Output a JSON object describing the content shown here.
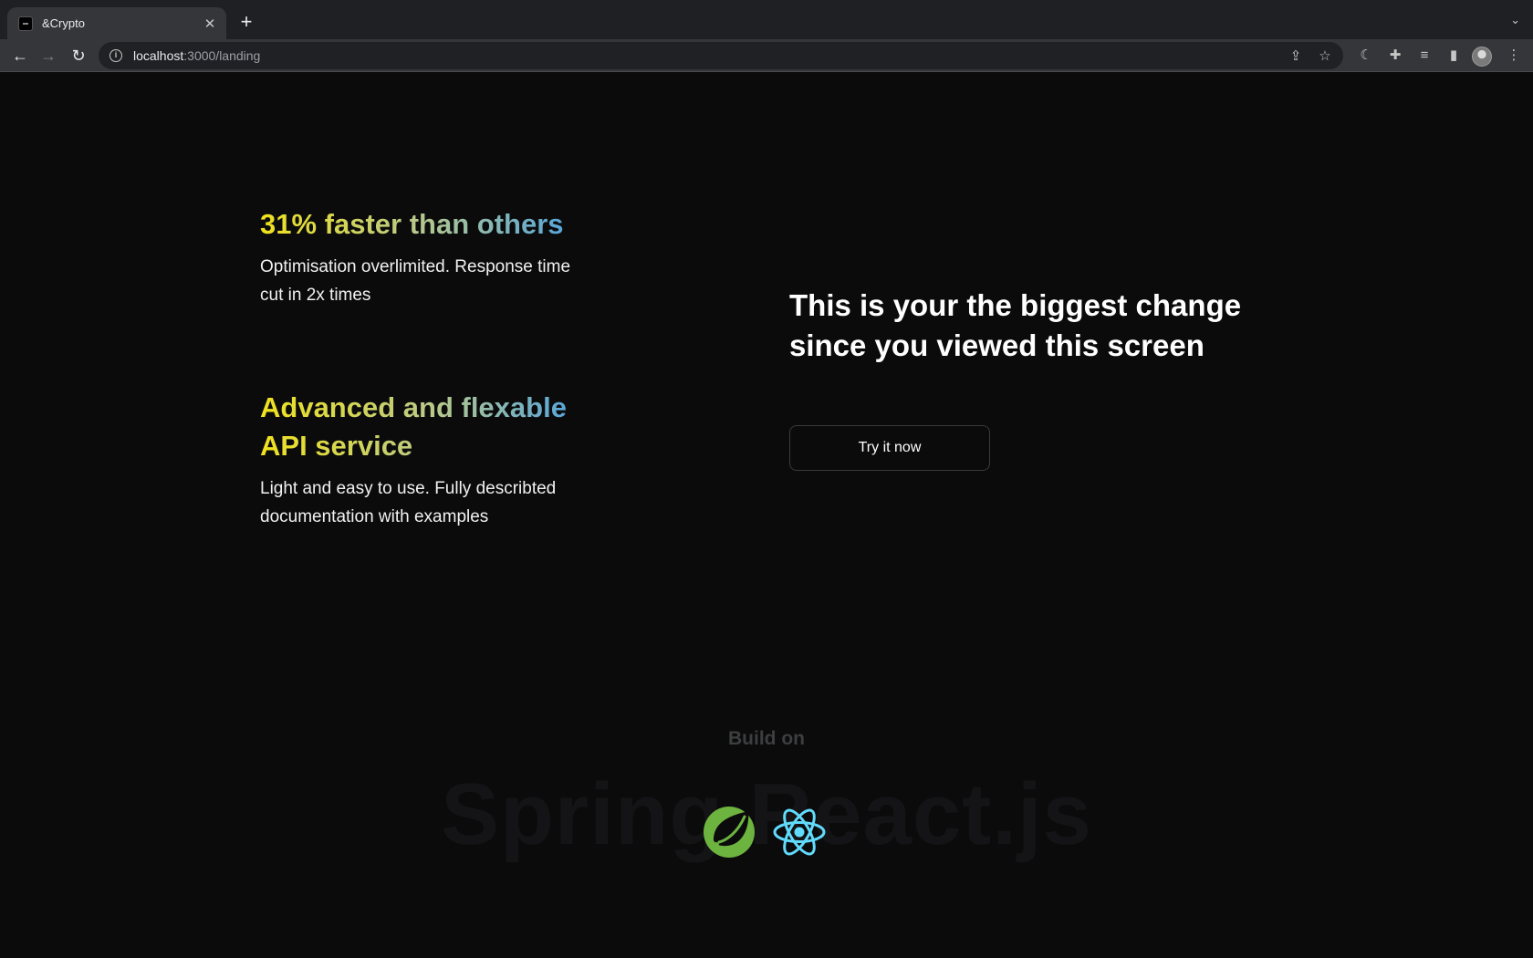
{
  "browser": {
    "tab_title": "&Crypto",
    "url_host": "localhost",
    "url_path": ":3000/landing"
  },
  "features": [
    {
      "title": "31% faster than others",
      "description": "Optimisation overlimited. Response time cut in 2x times"
    },
    {
      "title": "Advanced and flexable API service",
      "description": "Light and easy to use. Fully describted documentation with examples"
    }
  ],
  "hero": {
    "headline": "This is your the biggest change since you viewed this screen",
    "cta_label": "Try it now"
  },
  "build_on": {
    "label": "Build on",
    "background_text": "Spring React.js",
    "logos": [
      "spring-icon",
      "react-icon"
    ]
  },
  "colors": {
    "gradient_start": "#f1e21c",
    "gradient_mid": "#b8c98a",
    "gradient_end": "#3d9cf2",
    "spring_green": "#6db33f",
    "react_cyan": "#61dafb"
  }
}
